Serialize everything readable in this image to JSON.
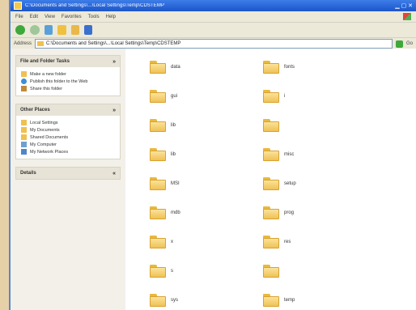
{
  "window": {
    "title": "C:\\Documents and Settings\\...\\Local Settings\\Temp\\CDSTEMP"
  },
  "menu": [
    "File",
    "Edit",
    "View",
    "Favorites",
    "Tools",
    "Help"
  ],
  "address": {
    "label": "Address",
    "value": "C:\\Documents and Settings\\...\\Local Settings\\Temp\\CDSTEMP",
    "go": "Go"
  },
  "tasks": {
    "file_folder": {
      "header": "File and Folder Tasks",
      "items": [
        "Make a new folder",
        "Publish this folder to the Web",
        "Share this folder"
      ]
    },
    "other_places": {
      "header": "Other Places",
      "items": [
        "Local Settings",
        "My Documents",
        "Shared Documents",
        "My Computer",
        "My Network Places"
      ]
    },
    "details": {
      "header": "Details"
    }
  },
  "folders": [
    {
      "name": "data"
    },
    {
      "name": "fonts"
    },
    {
      "name": "gui"
    },
    {
      "name": "i"
    },
    {
      "name": "lib"
    },
    {
      "name": ""
    },
    {
      "name": "lib"
    },
    {
      "name": "misc"
    },
    {
      "name": "MSI"
    },
    {
      "name": "setup"
    },
    {
      "name": "mdb"
    },
    {
      "name": "prog"
    },
    {
      "name": "x"
    },
    {
      "name": "res"
    },
    {
      "name": "s"
    },
    {
      "name": ""
    },
    {
      "name": "sys"
    },
    {
      "name": "temp"
    }
  ]
}
